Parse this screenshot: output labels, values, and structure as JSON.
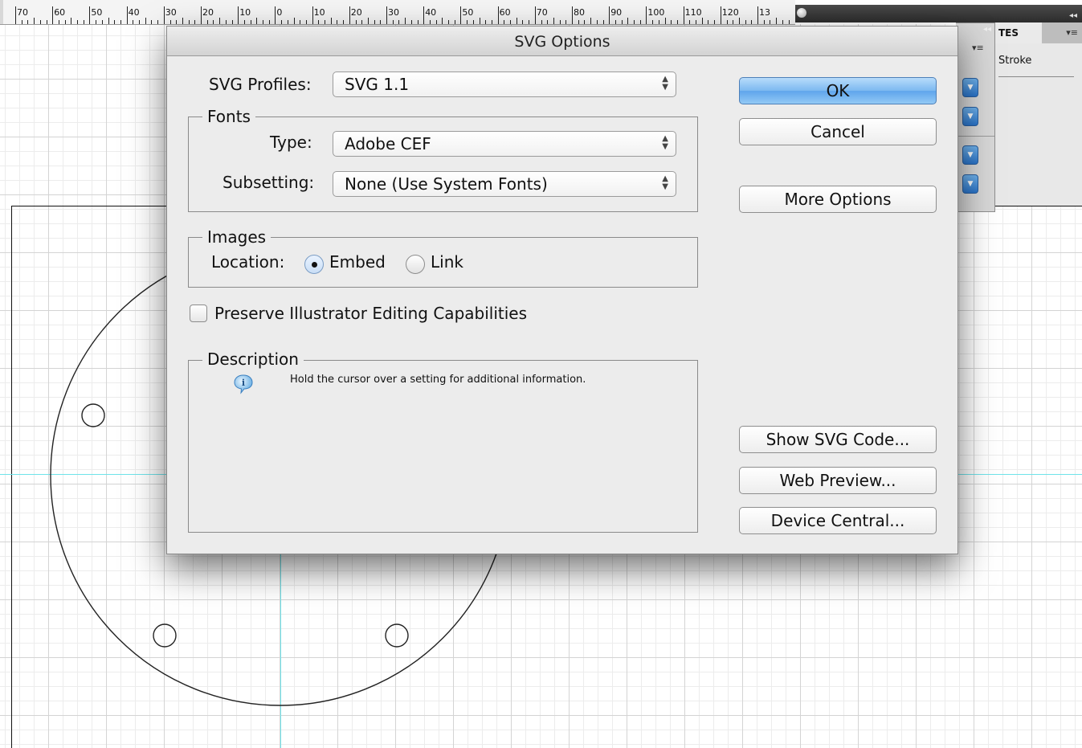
{
  "ruler": {
    "labels": [
      "70",
      "60",
      "50",
      "40",
      "30",
      "20",
      "10",
      "0",
      "10",
      "20",
      "30",
      "40",
      "50",
      "60",
      "70",
      "80",
      "90",
      "100",
      "110",
      "120",
      "13"
    ]
  },
  "side_panels": {
    "attributes_tab_label": "TES",
    "stroke_label": "Stroke"
  },
  "dialog": {
    "title": "SVG Options",
    "svg_profiles": {
      "label": "SVG Profiles:",
      "value": "SVG 1.1"
    },
    "fonts": {
      "legend": "Fonts",
      "type_label": "Type:",
      "type_value": "Adobe CEF",
      "subsetting_label": "Subsetting:",
      "subsetting_value": "None (Use System Fonts)"
    },
    "images": {
      "legend": "Images",
      "location_label": "Location:",
      "options": [
        {
          "label": "Embed",
          "selected": true
        },
        {
          "label": "Link",
          "selected": false
        }
      ]
    },
    "preserve": {
      "label": "Preserve Illustrator Editing Capabilities",
      "checked": false
    },
    "description": {
      "legend": "Description",
      "text": "Hold the cursor over a setting for additional information."
    },
    "buttons": {
      "ok": "OK",
      "cancel": "Cancel",
      "more_options": "More Options",
      "show_svg_code": "Show SVG Code...",
      "web_preview": "Web Preview...",
      "device_central": "Device Central..."
    }
  },
  "colors": {
    "guide": "#6fe3ea",
    "default_button": "#5fa5ec",
    "panel_dropdown": "#2a73c8"
  }
}
